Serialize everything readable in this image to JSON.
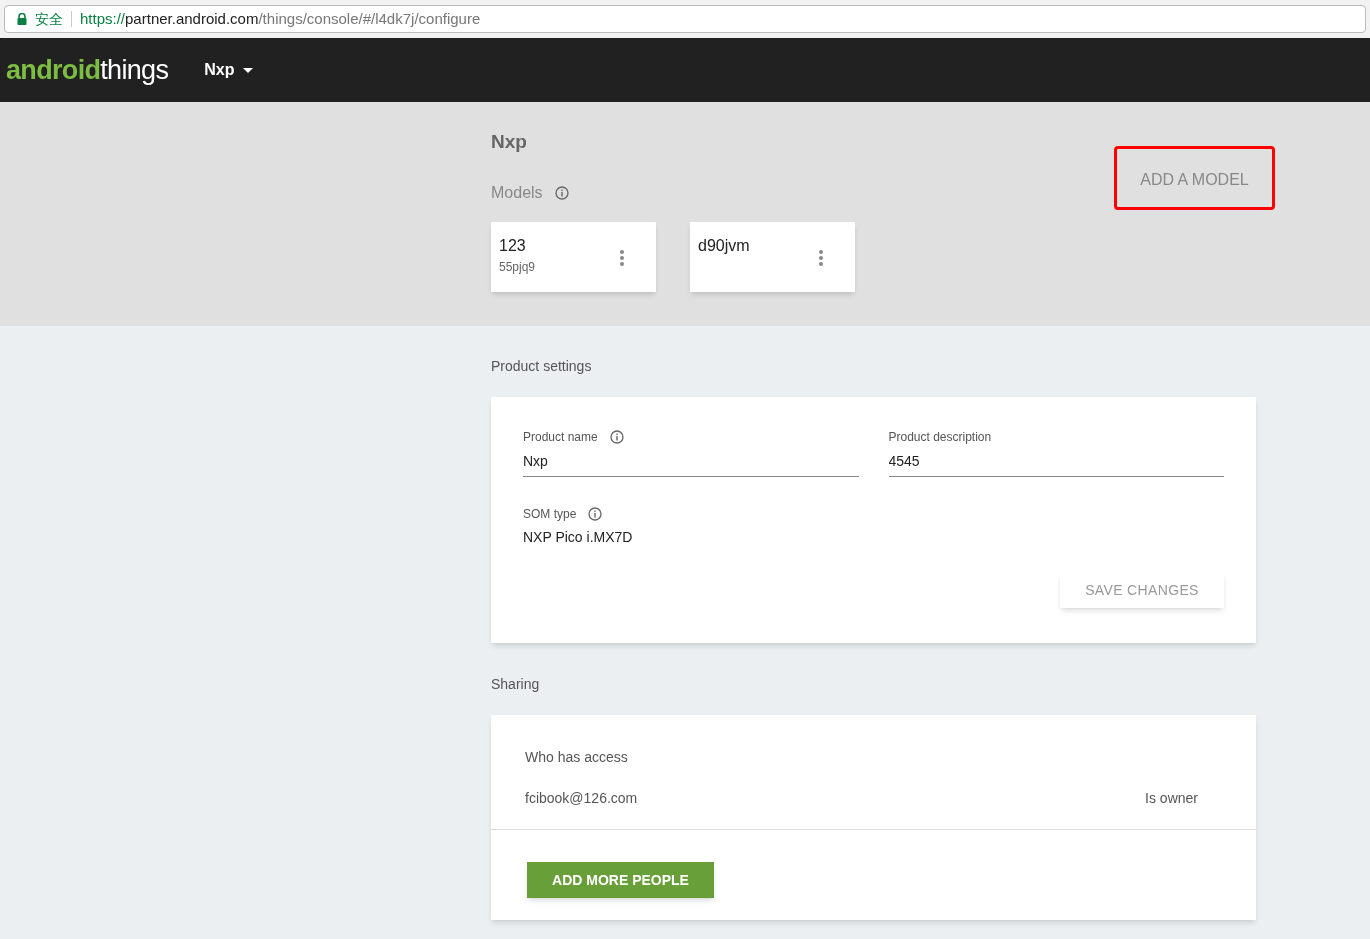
{
  "address_bar": {
    "secure_label": "安全",
    "url_host": "https://partner.android.com",
    "url_path": "/things/console/#/l4dk7j/configure"
  },
  "header": {
    "logo_first": "android",
    "logo_second": "things",
    "product_menu": "Nxp"
  },
  "product": {
    "title": "Nxp",
    "models_label": "Models",
    "add_model": {
      "label": "ADD A MODEL",
      "highlighted": true
    },
    "models": [
      {
        "name": "123",
        "id": "55pjq9"
      },
      {
        "name": "d90jvm"
      }
    ]
  },
  "product_settings": {
    "heading": "Product settings",
    "fields": [
      {
        "label": "Product name",
        "info": true,
        "value": "Nxp"
      },
      {
        "label": "Product description",
        "info": false,
        "value": "4545"
      }
    ],
    "som_label": "SOM type",
    "som_value": "NXP Pico i.MX7D",
    "save": {
      "label": "SAVE CHANGES",
      "disabled": true
    }
  },
  "sharing": {
    "heading": "Sharing",
    "who_label": "Who has access",
    "people": [
      {
        "email": "fcibook@126.com",
        "role": "Is owner"
      }
    ],
    "add_people": "ADD MORE PEOPLE"
  }
}
